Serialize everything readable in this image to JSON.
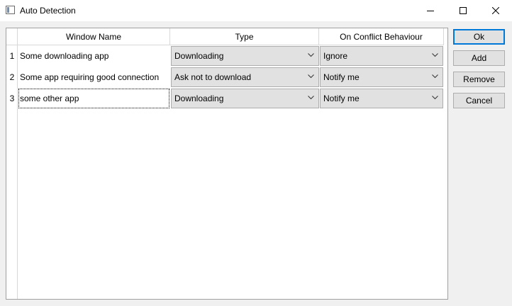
{
  "window": {
    "title": "Auto Detection"
  },
  "table": {
    "headers": [
      "Window Name",
      "Type",
      "On Conflict Behaviour"
    ],
    "rows": [
      {
        "num": "1",
        "name": "Some downloading app",
        "type": "Downloading",
        "conflict": "Ignore"
      },
      {
        "num": "2",
        "name": "Some app requiring good connection",
        "type": "Ask not to download",
        "conflict": "Notify me"
      },
      {
        "num": "3",
        "name": "some other app",
        "type": "Downloading",
        "conflict": "Notify me"
      }
    ]
  },
  "buttons": {
    "ok": "Ok",
    "add": "Add",
    "remove": "Remove",
    "cancel": "Cancel"
  },
  "icons": {
    "app": "window-app-icon",
    "minimize": "minimize-icon",
    "maximize": "maximize-icon",
    "close": "close-icon",
    "dropdown": "chevron-down-icon"
  },
  "colors": {
    "default_button_border": "#0078d7",
    "combo_bg": "#e1e1e1"
  }
}
